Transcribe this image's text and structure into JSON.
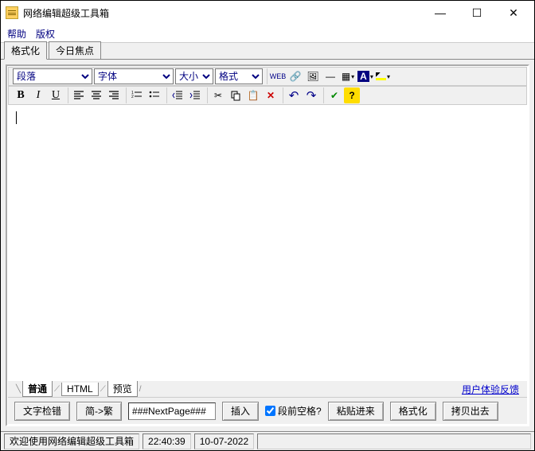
{
  "window": {
    "title": "网络编辑超级工具箱"
  },
  "menu": {
    "help": "帮助",
    "copyright": "版权"
  },
  "maintabs": {
    "format": "格式化",
    "today": "今日焦点"
  },
  "selects": {
    "paragraph": "段落",
    "font": "字体",
    "size": "大小",
    "style": "格式"
  },
  "icons": {
    "bold": "B",
    "italic": "I",
    "underline": "U",
    "undo": "↶",
    "redo": "↷"
  },
  "edittabs": {
    "normal": "普通",
    "html": "HTML",
    "preview": "预览"
  },
  "feedback": "用户体验反馈",
  "bottom": {
    "check": "文字检错",
    "simp2trad": "简->繁",
    "nextpage_value": "###NextPage###",
    "insert": "插入",
    "prespace": "段前空格?",
    "pastein": "粘贴进来",
    "format": "格式化",
    "copyout": "拷贝出去"
  },
  "status": {
    "welcome": "欢迎使用网络编辑超级工具箱",
    "time": "22:40:39",
    "date": "10-07-2022"
  }
}
